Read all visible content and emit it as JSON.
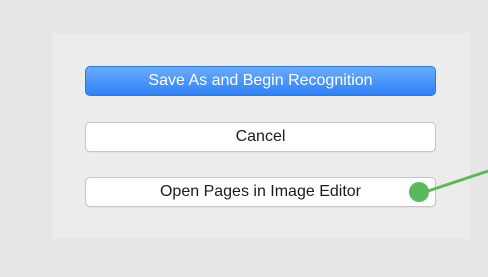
{
  "dialog": {
    "buttons": {
      "save_recognize": "Save As and Begin Recognition",
      "cancel": "Cancel",
      "open_in_editor": "Open Pages in Image Editor"
    }
  },
  "colors": {
    "primary_button": "#2e82f7",
    "marker": "#5cb85c",
    "background": "#e6e6e6"
  }
}
